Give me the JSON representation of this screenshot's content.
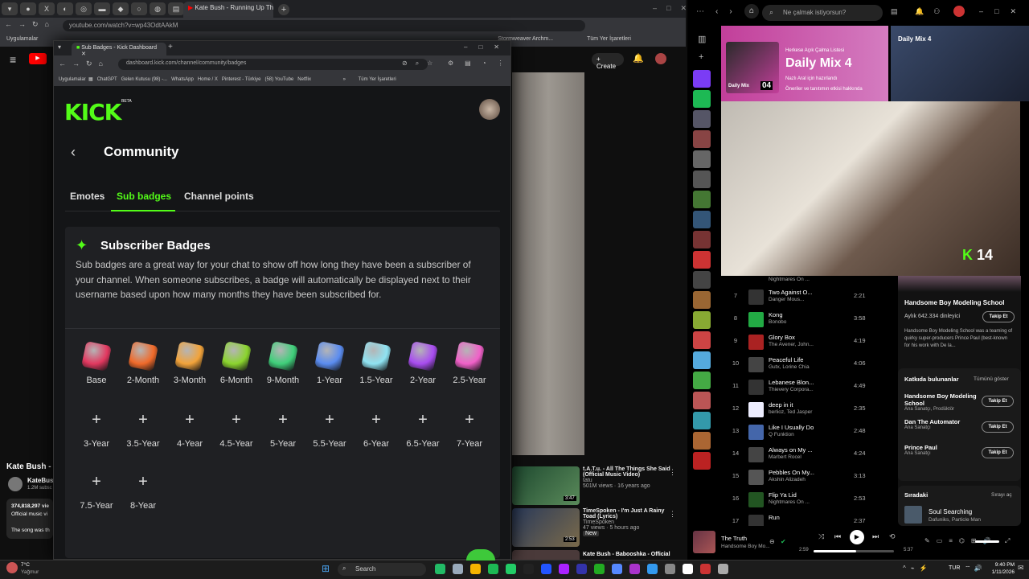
{
  "youtube_window": {
    "active_tab": "Kate Bush - Running Up Th...",
    "url": "youtube.com/watch?v=wp43OdtAAkM",
    "bookmarks_left": "Uygulamalar",
    "bookmarks_right": "Tüm Yer İşaretleri",
    "bookmark_mid": "Stormweaver Archm...",
    "create_label": "Create",
    "left_video_title": "Kate Bush - I",
    "left_channel": "KateBus",
    "left_subs": "1.2M subsc",
    "left_views": "374,818,297 vie",
    "left_desc": "Official music vi",
    "left_song": "The song was th",
    "recs": [
      {
        "title": "t.A.T.u. - All The Things She Said (Official Music Video)",
        "channel": "tatu",
        "meta": "501M views · 16 years ago",
        "duration": "3:47"
      },
      {
        "title": "TimeSpoken - I'm Just A Rainy Toad (Lyrics)",
        "channel": "TimeSpoken",
        "meta": "47 views · 5 hours ago",
        "badge": "New",
        "duration": "2:53"
      },
      {
        "title": "Kate Bush - Babooshka - Official",
        "channel": "",
        "meta": ""
      }
    ]
  },
  "kick_window": {
    "tab_title": "Sub Badges - Kick Dashboard",
    "url": "dashboard.kick.com/channel/community/badges",
    "bookmarks": [
      "Uygulamalar",
      "ChatGPT",
      "Gelen Kutusu (98) -...",
      "WhatsApp",
      "Home / X",
      "Pinterest - Türkiye",
      "(58) YouTube",
      "Netflix"
    ],
    "bookmarks_right": "Tüm Yer İşaretleri",
    "logo": "KICK",
    "beta": "BETA",
    "page_title": "Community",
    "tabs": [
      "Emotes",
      "Sub badges",
      "Channel points"
    ],
    "active_tab_index": 1,
    "panel_title": "Subscriber Badges",
    "panel_desc": "Sub badges are a great way for your chat to show off how long they have been a subscriber of your channel. When someone subscribes, a badge will automatically be displayed next to their username based upon how many months they have been subscribed for.",
    "badges_set": [
      {
        "label": "Base",
        "color": "#e2385f"
      },
      {
        "label": "2-Month",
        "color": "#f06a2a"
      },
      {
        "label": "3-Month",
        "color": "#f2a33a"
      },
      {
        "label": "6-Month",
        "color": "#8bd42e"
      },
      {
        "label": "9-Month",
        "color": "#3fcf7a"
      },
      {
        "label": "1-Year",
        "color": "#5a8cf0"
      },
      {
        "label": "1.5-Year",
        "color": "#8fe3f2"
      },
      {
        "label": "2-Year",
        "color": "#a84cf0"
      },
      {
        "label": "2.5-Year",
        "color": "#f060c8"
      }
    ],
    "badges_empty": [
      "3-Year",
      "3.5-Year",
      "4-Year",
      "4.5-Year",
      "5-Year",
      "5.5-Year",
      "6-Year",
      "6.5-Year",
      "7-Year",
      "7.5-Year",
      "8-Year"
    ],
    "plus_symbol": "+"
  },
  "spotify": {
    "search_placeholder": "Ne çalmak istiyorsun?",
    "banner_small": "Herkese Açık Çalma Listesi",
    "banner_title": "Daily Mix 4",
    "banner_by": "Nazlı Aral için hazırlandı",
    "banner_note": "Öneriler ve tanıtımın etkisi hakkında",
    "banner_cover_label": "Daily Mix",
    "banner_cover_num": "04",
    "right_title": "Daily Mix 4",
    "cam_count": "14",
    "cam_k": "K",
    "top_partial": "Nightmares On ...",
    "tracks": [
      {
        "n": "7",
        "title": "Two Against O...",
        "artist": "Danger Mous...",
        "dur": "2:21"
      },
      {
        "n": "8",
        "title": "Kong",
        "artist": "Bonobo",
        "dur": "3:58"
      },
      {
        "n": "9",
        "title": "Glory Box",
        "artist": "The Avener, John...",
        "dur": "4:19"
      },
      {
        "n": "10",
        "title": "Peaceful Life",
        "artist": "Gutx, Lorine Chia",
        "dur": "4:06"
      },
      {
        "n": "11",
        "title": "Lebanese Blon...",
        "artist": "Thievery Corpora...",
        "dur": "4:49"
      },
      {
        "n": "12",
        "title": "deep in it",
        "artist": "berlioz, Ted Jasper",
        "dur": "2:35"
      },
      {
        "n": "13",
        "title": "Like I Usually Do",
        "artist": "Q Funktion",
        "dur": "2:48"
      },
      {
        "n": "14",
        "title": "Always on My ...",
        "artist": "Marbert Rocel",
        "dur": "4:24"
      },
      {
        "n": "15",
        "title": "Pebbles On My...",
        "artist": "Akshin Alizadeh",
        "dur": "3:13"
      },
      {
        "n": "16",
        "title": "Flip Ya Lid",
        "artist": "Nightmares On ...",
        "dur": "2:53"
      },
      {
        "n": "17",
        "title": "Run",
        "artist": "",
        "dur": "2:37"
      }
    ],
    "artist_name": "Handsome Boy Modeling School",
    "artist_listeners": "Aylık 642.334 dinleyici",
    "follow": "Takip Et",
    "artist_bio": "Handsome Boy Modeling School was a teaming of quirky super-producers Prince Paul (best-known for his work with De la...",
    "contributors_title": "Katkıda bulunanlar",
    "show_all": "Tümünü göster",
    "contributors": [
      {
        "name": "Handsome Boy Modeling School",
        "role": "Ana Sanatçı, Prodüktör"
      },
      {
        "name": "Dan The Automator",
        "role": "Ana Sanatçı"
      },
      {
        "name": "Prince Paul",
        "role": "Ana Sanatçı"
      }
    ],
    "queue_title": "Sıradaki",
    "queue_open": "Sırayı aç",
    "queue_song": "Soul Searching",
    "queue_artist": "Dafuniks, Particle Man",
    "now_playing": "The Truth",
    "now_artist": "Handsome Boy Mo...",
    "elapsed": "2:59",
    "total": "5:37",
    "progress_fraction": 0.53
  },
  "taskbar": {
    "weather_temp": "7°C",
    "weather_desc": "Yağmur",
    "search": "Search",
    "lang": "TUR",
    "time": "9:40 PM",
    "date": "1/11/2026"
  }
}
